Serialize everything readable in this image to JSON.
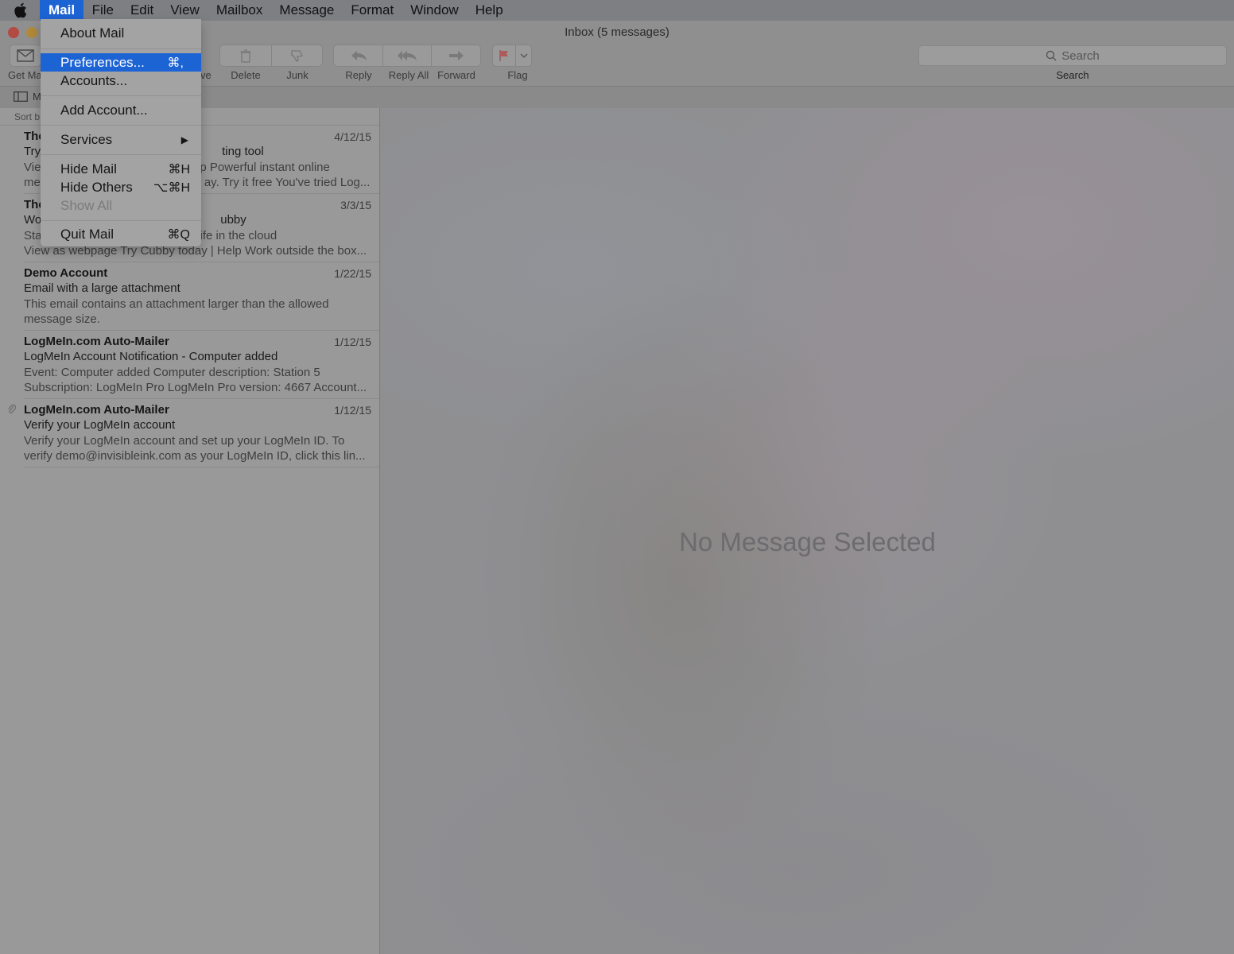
{
  "menubar": {
    "items": [
      "Mail",
      "File",
      "Edit",
      "View",
      "Mailbox",
      "Message",
      "Format",
      "Window",
      "Help"
    ],
    "active": "Mail"
  },
  "window": {
    "title": "Inbox (5 messages)"
  },
  "toolbar": {
    "get_mail": "Get Ma",
    "move_fragment": "ve",
    "delete": "Delete",
    "junk": "Junk",
    "reply": "Reply",
    "reply_all": "Reply All",
    "forward": "Forward",
    "flag": "Flag",
    "search_placeholder": "Search",
    "search_label": "Search"
  },
  "favbar": {
    "mailboxes_fragment": "M"
  },
  "list": {
    "sort_fragment": "Sort b",
    "messages": [
      {
        "from": "The",
        "subject_a": "Try",
        "subject_b": "ting tool",
        "date": "4/12/15",
        "p1a": "Vie",
        "p1b": "p Powerful instant online",
        "p2a": "me",
        "p2b": "ay. Try it free You've tried Log..."
      },
      {
        "from": "The",
        "subject_a": "Wo",
        "subject_b": "ubby",
        "date": "3/3/15",
        "p1a": "Sta",
        "p1b": "ife in the cloud",
        "p2a": "View as webpage Try Cubby today | Help Work outside the box...",
        "p2b": ""
      },
      {
        "from": "Demo Account",
        "subject": "Email with a large attachment",
        "date": "1/22/15",
        "preview": "This email contains an attachment larger than the allowed message size."
      },
      {
        "from": "LogMeIn.com Auto-Mailer",
        "subject": "LogMeIn Account Notification - Computer added",
        "date": "1/12/15",
        "preview": "Event: Computer added Computer description: Station 5 Subscription: LogMeIn Pro LogMeIn Pro version: 4667 Account..."
      },
      {
        "from": "LogMeIn.com Auto-Mailer",
        "subject": "Verify your LogMeIn account",
        "date": "1/12/15",
        "preview": "Verify your LogMeIn account and set up your LogMeIn ID. To verify demo@invisibleink.com as your LogMeIn ID, click this lin...",
        "attachment_icon": "paperclip-icon"
      }
    ]
  },
  "reading": {
    "empty_text": "No Message Selected"
  },
  "dropdown": {
    "about": "About Mail",
    "preferences": "Preferences...",
    "preferences_shortcut": "⌘,",
    "accounts": "Accounts...",
    "add_account": "Add Account...",
    "services": "Services",
    "hide_mail": "Hide Mail",
    "hide_mail_shortcut": "⌘H",
    "hide_others": "Hide Others",
    "hide_others_shortcut": "⌥⌘H",
    "show_all": "Show All",
    "quit": "Quit Mail",
    "quit_shortcut": "⌘Q"
  },
  "colors": {
    "accent": "#1c63d4"
  }
}
